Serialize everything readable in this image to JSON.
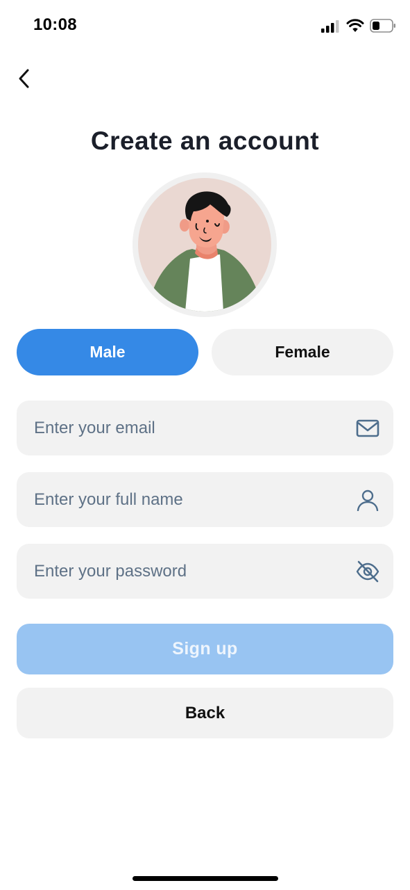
{
  "status_bar": {
    "time": "10:08",
    "icons": [
      "cellular-signal-icon",
      "wifi-icon",
      "battery-icon"
    ]
  },
  "nav": {
    "back_icon": "chevron-left-icon"
  },
  "header": {
    "title": "Create an account"
  },
  "avatar": {
    "icon": "user-avatar-illustration"
  },
  "gender": {
    "male_label": "Male",
    "female_label": "Female",
    "selected": "Male"
  },
  "form": {
    "email": {
      "placeholder": "Enter your email",
      "value": "",
      "icon": "mail-icon"
    },
    "full_name": {
      "placeholder": "Enter your full name",
      "value": "",
      "icon": "person-icon"
    },
    "password": {
      "placeholder": "Enter your password",
      "value": "",
      "icon": "eye-off-icon"
    }
  },
  "actions": {
    "signup_label": "Sign up",
    "back_label": "Back"
  },
  "colors": {
    "accent": "#3589e6",
    "accent_disabled": "#98c4f2",
    "field_bg": "#f2f2f2",
    "title": "#1b1f2a",
    "placeholder": "#5e7186"
  }
}
